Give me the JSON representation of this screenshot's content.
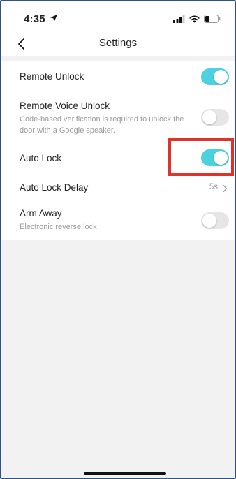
{
  "status_bar": {
    "time": "4:35",
    "icons": [
      "location-arrow-icon",
      "cellular-signal-icon",
      "wifi-icon",
      "battery-icon"
    ]
  },
  "nav": {
    "title": "Settings",
    "back_icon": "chevron-left-icon"
  },
  "settings": {
    "remote_unlock": {
      "label": "Remote Unlock",
      "enabled": true
    },
    "remote_voice_unlock": {
      "label": "Remote Voice Unlock",
      "description": "Code-based verification is required to unlock the door with a Google speaker.",
      "enabled": false
    },
    "auto_lock": {
      "label": "Auto Lock",
      "enabled": true
    },
    "auto_lock_delay": {
      "label": "Auto Lock Delay",
      "value": "5s"
    },
    "arm_away": {
      "label": "Arm Away",
      "description": "Electronic reverse lock",
      "enabled": false
    }
  },
  "colors": {
    "toggle_on": "#4cd1e0",
    "toggle_off": "#e6e6e6",
    "highlight": "#e0322a",
    "background": "#f2f2f2"
  }
}
